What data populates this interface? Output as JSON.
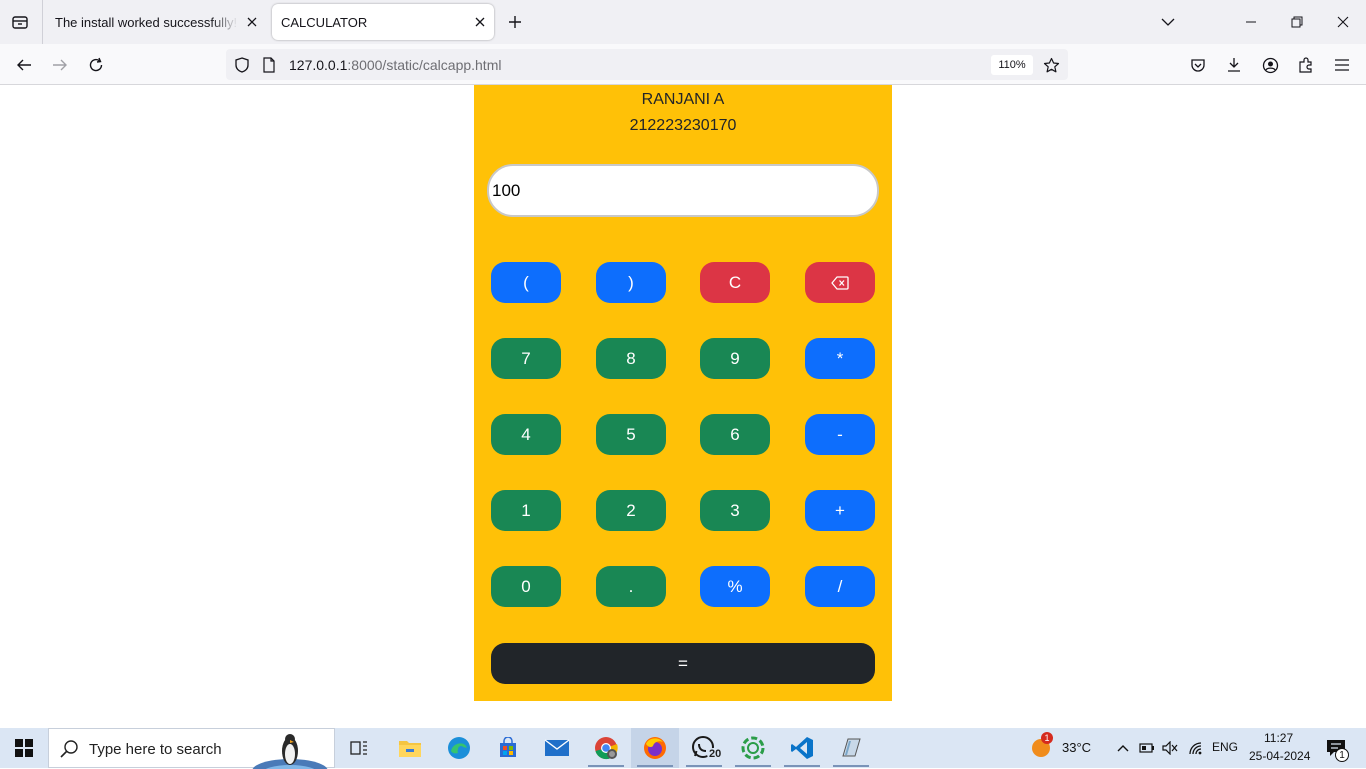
{
  "browser": {
    "tabs": [
      {
        "title": "The install worked successfully! Congratulations!",
        "active": false
      },
      {
        "title": "CALCULATOR",
        "active": true
      }
    ],
    "url": {
      "host": "127.0.0.1",
      "rest": ":8000/static/calcapp.html"
    },
    "zoom": "110%"
  },
  "calculator": {
    "name": "RANJANI A",
    "roll": "212223230170",
    "display_value": "100",
    "keys": {
      "open_paren": "(",
      "close_paren": ")",
      "clear": "C",
      "seven": "7",
      "eight": "8",
      "nine": "9",
      "multiply": "*",
      "four": "4",
      "five": "5",
      "six": "6",
      "minus": "-",
      "one": "1",
      "two": "2",
      "three": "3",
      "plus": "+",
      "zero": "0",
      "dot": ".",
      "percent": "%",
      "divide": "/",
      "equals": "="
    },
    "colors": {
      "panel": "#ffc107",
      "primary": "#0d6efd",
      "danger": "#dc3545",
      "success": "#198754",
      "dark": "#212529"
    }
  },
  "taskbar": {
    "search_placeholder": "Type here to search",
    "whatsapp_badge": "20",
    "weather": "33°C",
    "weather_alert": "1",
    "language": "ENG",
    "time": "11:27",
    "date": "25-04-2024",
    "notification_count": "1"
  }
}
